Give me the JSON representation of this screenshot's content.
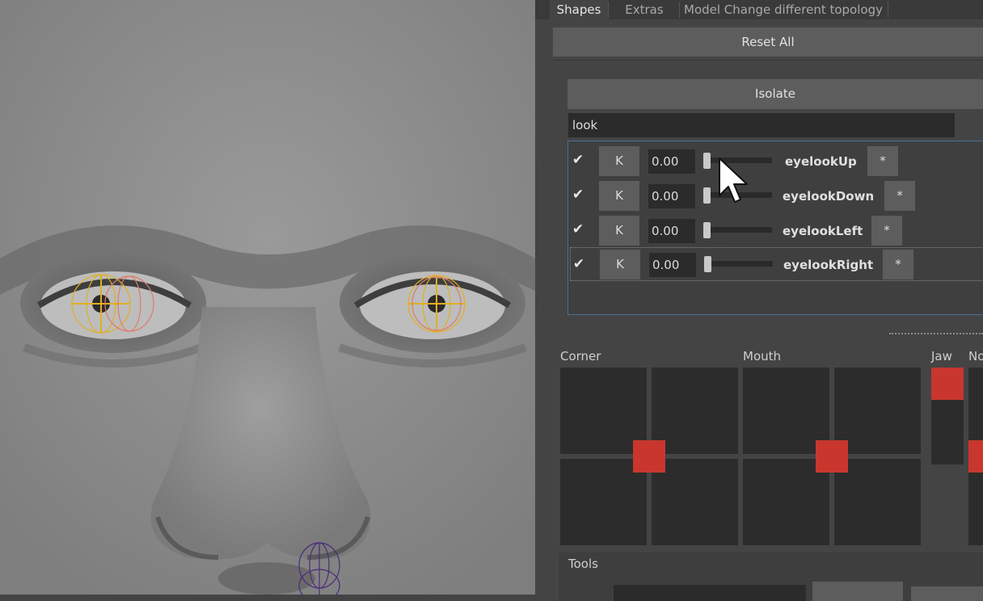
{
  "tabs": [
    {
      "label": "Shapes",
      "active": true
    },
    {
      "label": "Extras",
      "active": false
    },
    {
      "label": "Model Change different topology",
      "active": false
    }
  ],
  "reset_all_label": "Reset All",
  "isolate_label": "Isolate",
  "search": {
    "value": "look"
  },
  "shapes": [
    {
      "checked": true,
      "k_label": "K",
      "value": "0.00",
      "name": "eyelookUp",
      "star": "*"
    },
    {
      "checked": true,
      "k_label": "K",
      "value": "0.00",
      "name": "eyelookDown",
      "star": "*"
    },
    {
      "checked": true,
      "k_label": "K",
      "value": "0.00",
      "name": "eyelookLeft",
      "star": "*"
    },
    {
      "checked": true,
      "k_label": "K",
      "value": "0.00",
      "name": "eyelookRight",
      "star": "*"
    }
  ],
  "pads": {
    "corner_label": "Corner",
    "mouth_label": "Mouth",
    "jaw_label": "Jaw",
    "extra_label": "No"
  },
  "tools_label": "Tools",
  "colors": {
    "accent_red": "#c8362e",
    "panel_bg": "#444444",
    "field_bg": "#2b2b2b"
  }
}
